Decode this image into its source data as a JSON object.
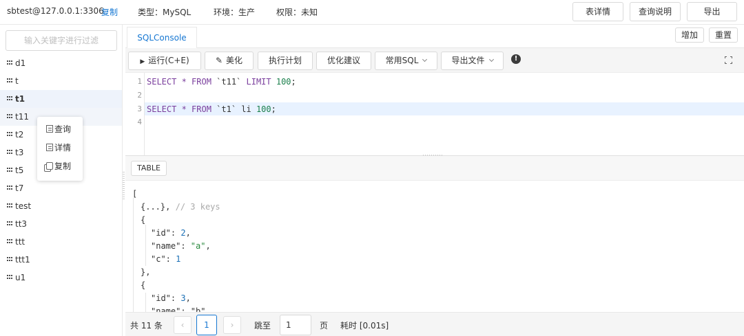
{
  "topbar": {
    "connection": "sbtest@127.0.0.1:3306",
    "copy_link": "复制",
    "type": "类型：MySQL",
    "env": "环境：生产",
    "permission": "权限：未知",
    "buttons": {
      "table_detail": "表详情",
      "query_help": "查询说明",
      "export": "导出"
    }
  },
  "sidebar": {
    "filter_placeholder": "输入关键字进行过滤",
    "tables": [
      "d1",
      "t",
      "t1",
      "t11",
      "t2",
      "t3",
      "t5",
      "t7",
      "test",
      "tt3",
      "ttt",
      "ttt1",
      "u1"
    ],
    "selected": "t1",
    "context_menu": {
      "query": "查询",
      "detail": "详情",
      "copy": "复制"
    }
  },
  "tabs": {
    "console": "SQLConsole",
    "add": "增加",
    "reset": "重置"
  },
  "toolbar": {
    "run": "运行(C+E)",
    "beautify": "美化",
    "explain": "执行计划",
    "optimize": "优化建议",
    "common_sql": "常用SQL",
    "export_file": "导出文件"
  },
  "editor": {
    "line_numbers": [
      "1",
      "2",
      "3",
      "4"
    ],
    "line1": {
      "kw1": "SELECT * FROM",
      "tbl": " `t11` ",
      "kw2": "LIMIT",
      "num": " 100",
      "end": ";"
    },
    "line3": {
      "kw1": "SELECT * FROM",
      "tbl": " `t1` li",
      "num": " 100",
      "end": ";"
    }
  },
  "result": {
    "view_button": "TABLE",
    "json": {
      "open": "[",
      "collapsed": "{...},",
      "collapsed_comment": "// 3 keys",
      "obj_open": "{",
      "id_key": "\"id\": ",
      "id1": "2",
      "name_key": "\"name\": ",
      "name1": "\"a\"",
      "c_key": "\"c\": ",
      "c1": "1",
      "obj_close": "},",
      "obj2_open": "{",
      "id2": "3",
      "name2_partial": "\"name\": \"b\""
    }
  },
  "pager": {
    "total": "共 11 条",
    "prev": "‹",
    "current": "1",
    "next": "›",
    "jump_label": "跳至",
    "jump_value": "1",
    "page_label": "页",
    "elapsed": "耗时 [0.01s]"
  },
  "colors": {
    "accent": "#1677d2",
    "selected_row": "#eef3fb",
    "active_line": "#e8f2ff"
  }
}
